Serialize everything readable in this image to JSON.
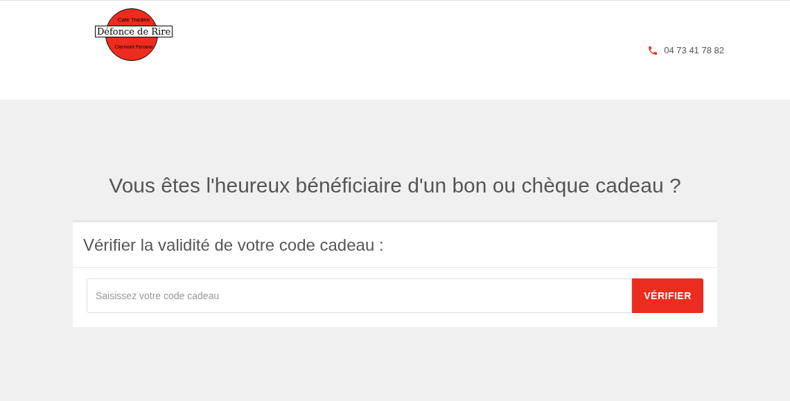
{
  "logo": {
    "top": "Café Théâtre",
    "name": "Défonce de Rire",
    "bottom": "Clermont Ferrand"
  },
  "phone": "04 73 41 78 82",
  "heading": "Vous êtes l'heureux bénéficiaire d'un bon ou chèque cadeau ?",
  "card": {
    "title": "Vérifier la validité de votre code cadeau :",
    "field": {
      "placeholder": "Saisissez votre code cadeau"
    },
    "button": "VÉRIFIER"
  }
}
